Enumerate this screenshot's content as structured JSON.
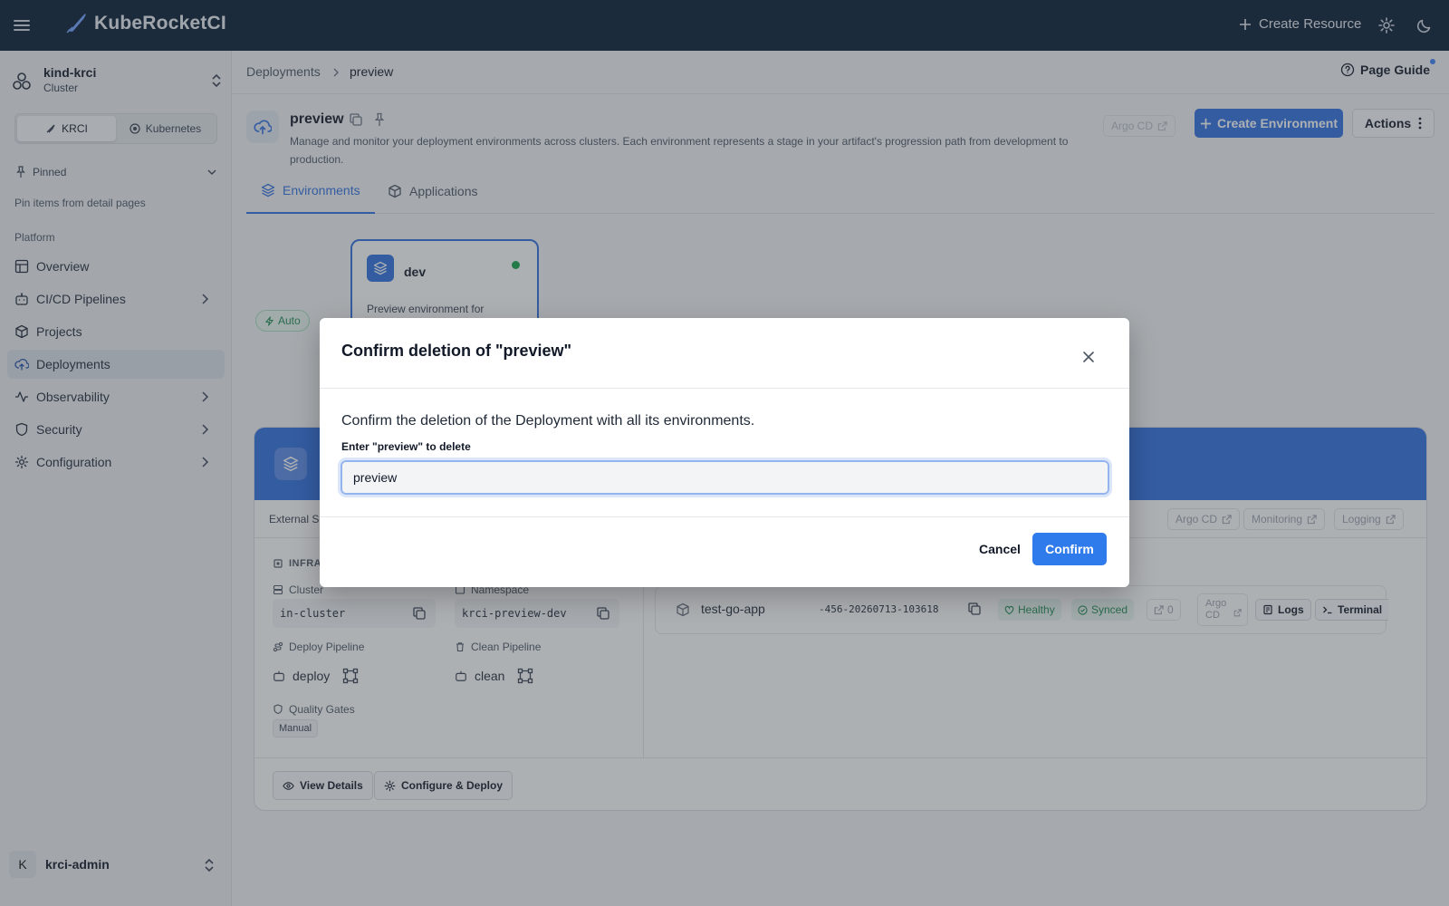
{
  "app": {
    "brand": "KubeRocketCI",
    "create_resource": "Create Resource"
  },
  "sidebar": {
    "cluster_name": "kind-krci",
    "cluster_type": "Cluster",
    "switch": [
      "KRCI",
      "Kubernetes"
    ],
    "pinned_label": "Pinned",
    "pinned_hint": "Pin items from detail pages",
    "section_label": "Platform",
    "items": [
      {
        "label": "Overview"
      },
      {
        "label": "CI/CD Pipelines"
      },
      {
        "label": "Projects"
      },
      {
        "label": "Deployments"
      },
      {
        "label": "Observability"
      },
      {
        "label": "Security"
      },
      {
        "label": "Configuration"
      }
    ],
    "user_initial": "K",
    "user_name": "krci-admin"
  },
  "breadcrumb": {
    "parent": "Deployments",
    "current": "preview"
  },
  "page_guide": "Page Guide",
  "header": {
    "title": "preview",
    "description": "Manage and monitor your deployment environments across clusters. Each environment represents a stage in your artifact's progression path from development to production.",
    "argo_link": "Argo CD",
    "create_env": "Create Environment",
    "actions": "Actions"
  },
  "tabs": [
    {
      "label": "Environments"
    },
    {
      "label": "Applications"
    }
  ],
  "graph": {
    "auto_badge": "Auto",
    "env_card": {
      "name": "dev",
      "desc": "Preview environment for"
    }
  },
  "env_panel": {
    "ext_label": "External Se",
    "ext_links": [
      "Argo CD",
      "Monitoring",
      "Logging"
    ],
    "infra_label": "INFRA",
    "cluster_label": "Cluster",
    "cluster_value": "in-cluster",
    "namespace_label": "Namespace",
    "namespace_value": "krci-preview-dev",
    "deploy_pipeline_label": "Deploy Pipeline",
    "deploy_pipeline_value": "deploy",
    "clean_pipeline_label": "Clean Pipeline",
    "clean_pipeline_value": "clean",
    "quality_gates_label": "Quality Gates",
    "quality_gates_value": "Manual",
    "app": {
      "name": "test-go-app",
      "version": "-456-20260713-103618",
      "health": "Healthy",
      "sync": "Synced",
      "ports": "0",
      "argo_line1": "Argo",
      "argo_line2": "CD",
      "logs": "Logs",
      "terminal": "Terminal"
    },
    "view_details": "View Details",
    "configure_deploy": "Configure & Deploy"
  },
  "dialog": {
    "title": "Confirm deletion of \"preview\"",
    "message": "Confirm the deletion of the Deployment with all its environments.",
    "input_label": "Enter \"preview\" to delete",
    "input_value": "preview",
    "cancel": "Cancel",
    "confirm": "Confirm"
  },
  "colors": {
    "topbar": "#061a33",
    "primary": "#2f6fe0",
    "confirm": "#2f7bec",
    "healthy": "#16a34a"
  }
}
